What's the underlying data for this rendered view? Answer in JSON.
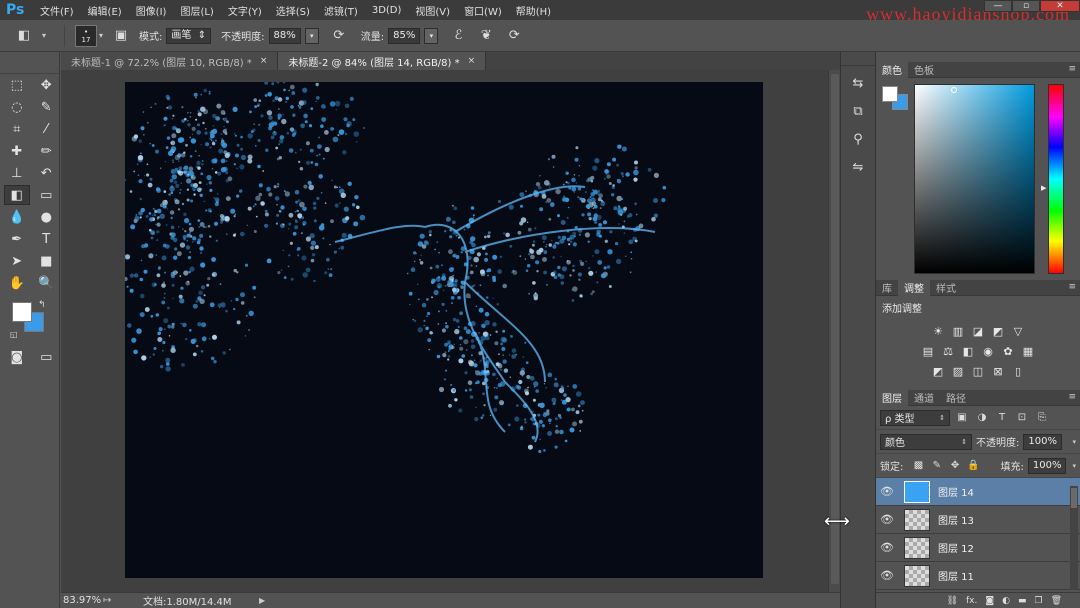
{
  "app": {
    "logo": "Ps",
    "watermark": "www.haoyidianshop.com",
    "window_controls": [
      "—",
      "▫",
      "✕"
    ]
  },
  "menu": [
    "文件(F)",
    "编辑(E)",
    "图像(I)",
    "图层(L)",
    "文字(Y)",
    "选择(S)",
    "滤镜(T)",
    "3D(D)",
    "视图(V)",
    "窗口(W)",
    "帮助(H)"
  ],
  "options": {
    "brush_size": "17",
    "mode_label": "模式:",
    "mode_value": "画笔",
    "opacity_label": "不透明度:",
    "opacity_value": "88%",
    "flow_label": "流量:",
    "flow_value": "85%"
  },
  "tabs": [
    {
      "label": "未标题-1 @ 72.2% (图层 10, RGB/8) *",
      "close": "×"
    },
    {
      "label": "未标题-2 @ 84% (图层 14, RGB/8) *",
      "close": "×"
    }
  ],
  "status": {
    "zoom": "83.97%",
    "doc_info": "文档:1.80M/14.4M",
    "arrow": "▶"
  },
  "panels": {
    "color_tabs": [
      "颜色",
      "色板"
    ],
    "adjust_tabs": [
      "库",
      "调整",
      "样式"
    ],
    "adjust_title": "添加调整",
    "layers_tabs": [
      "图层",
      "通道",
      "路径"
    ],
    "filter_kind": "ρ 类型",
    "blend_mode": "颜色",
    "opacity_label": "不透明度:",
    "opacity_value": "100%",
    "lock_label": "锁定:",
    "fill_label": "填充:",
    "fill_value": "100%",
    "menu_icon": "≡"
  },
  "layers": [
    {
      "name": "图层 14",
      "selected": true,
      "filled": true
    },
    {
      "name": "图层 13",
      "selected": false,
      "filled": false
    },
    {
      "name": "图层 12",
      "selected": false,
      "filled": false
    },
    {
      "name": "图层 11",
      "selected": false,
      "filled": false
    }
  ],
  "colors": {
    "foreground": "#ffffff",
    "background": "#3c9be8",
    "canvas": "#050a14",
    "accent": "#39a8f0"
  },
  "icons": {
    "tools": [
      [
        "marquee-icon",
        "⬚",
        "move-icon",
        "✥"
      ],
      [
        "lasso-icon",
        "◌",
        "quick-select-icon",
        "✎"
      ],
      [
        "crop-icon",
        "⌗",
        "eyedropper-icon",
        "⁄"
      ],
      [
        "healing-icon",
        "✚",
        "brush-icon",
        "✏"
      ],
      [
        "stamp-icon",
        "⊥",
        "history-brush-icon",
        "↶"
      ],
      [
        "eraser-icon",
        "◧",
        "gradient-icon",
        "▭"
      ],
      [
        "blur-icon",
        "💧",
        "dodge-icon",
        "●"
      ],
      [
        "pen-icon",
        "✒",
        "type-icon",
        "T"
      ],
      [
        "path-select-icon",
        "➤",
        "shape-icon",
        "■"
      ],
      [
        "hand-icon",
        "✋",
        "zoom-icon",
        "🔍"
      ]
    ]
  }
}
